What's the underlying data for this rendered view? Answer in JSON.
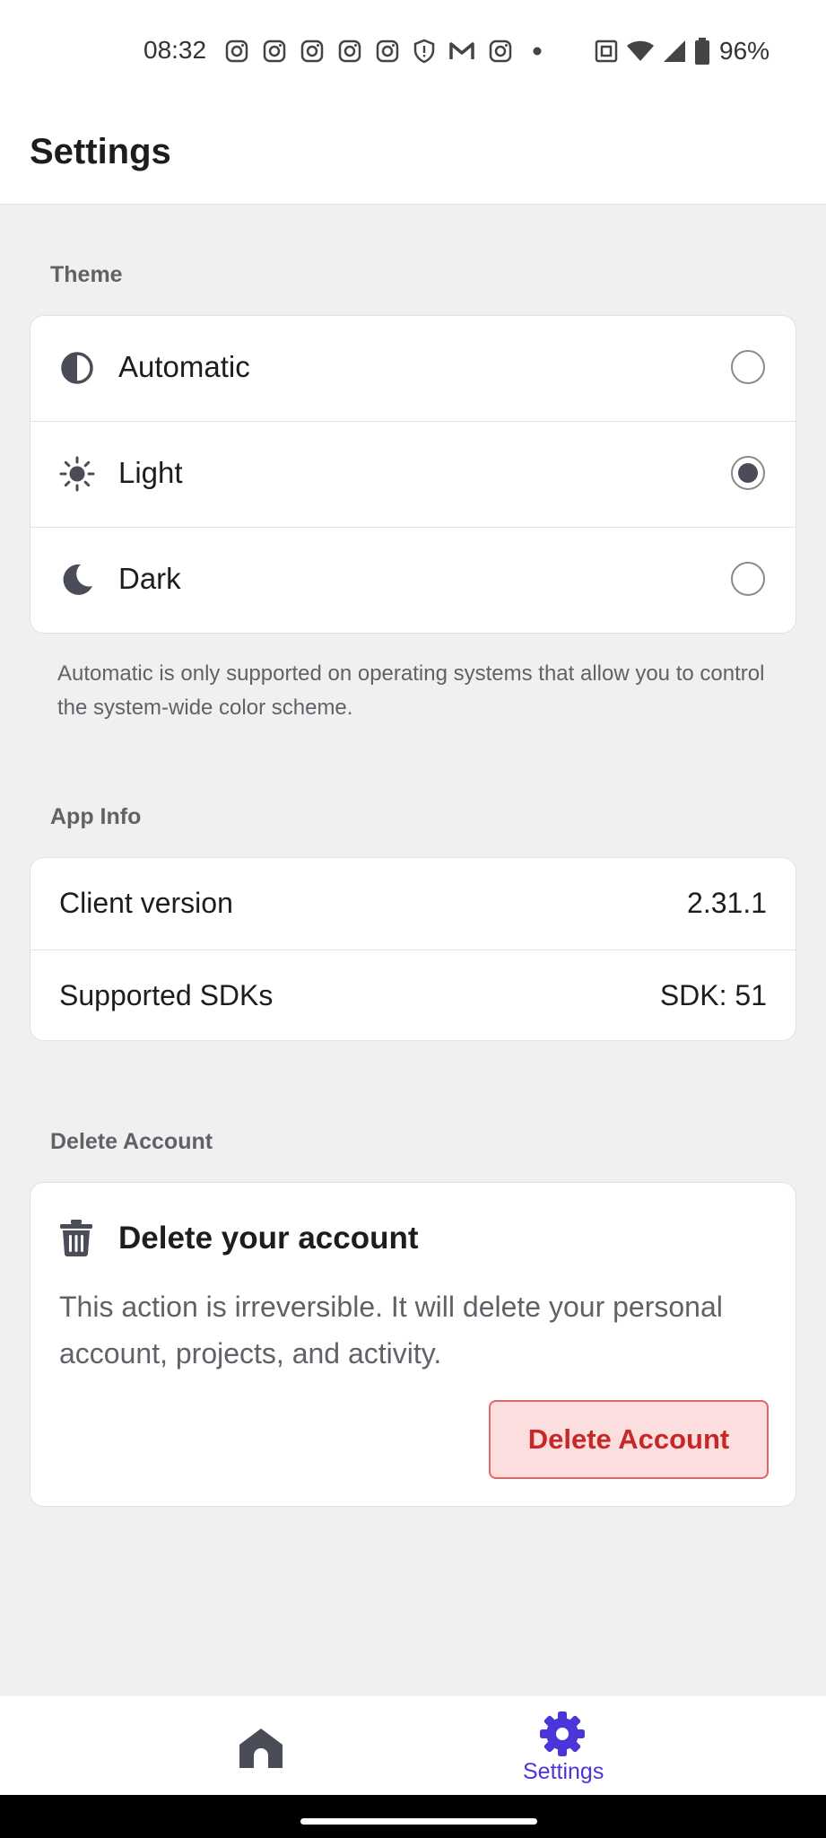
{
  "status_bar": {
    "time": "08:32",
    "battery": "96%",
    "icons": [
      "instagram-icon",
      "instagram-icon",
      "instagram-icon",
      "instagram-icon",
      "instagram-icon",
      "shield-icon",
      "gmail-icon",
      "instagram-icon",
      "dot-icon",
      "nfc-icon",
      "wifi-icon",
      "signal-icon",
      "battery-icon"
    ]
  },
  "header": {
    "title": "Settings"
  },
  "theme": {
    "label": "Theme",
    "options": [
      {
        "label": "Automatic",
        "icon": "half-circle-icon",
        "selected": false
      },
      {
        "label": "Light",
        "icon": "sun-icon",
        "selected": true
      },
      {
        "label": "Dark",
        "icon": "moon-icon",
        "selected": false
      }
    ],
    "note": "Automatic is only supported on operating systems that allow you to control the system-wide color scheme."
  },
  "app_info": {
    "label": "App Info",
    "rows": [
      {
        "key": "Client version",
        "value": "2.31.1"
      },
      {
        "key": "Supported SDKs",
        "value": "SDK: 51"
      }
    ]
  },
  "delete_account": {
    "label": "Delete Account",
    "title": "Delete your account",
    "description": "This action is irreversible. It will delete your personal account, projects, and activity.",
    "button": "Delete Account"
  },
  "bottom_nav": {
    "items": [
      {
        "label": "",
        "icon": "home-icon",
        "active": false
      },
      {
        "label": "Settings",
        "icon": "gear-icon",
        "active": true
      }
    ]
  },
  "colors": {
    "accent": "#4a35d8",
    "danger": "#c62828",
    "danger_bg": "#fddede",
    "background": "#f0f0f0"
  }
}
